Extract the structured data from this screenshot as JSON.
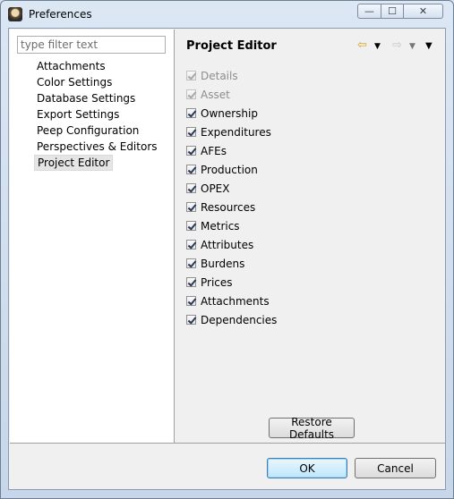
{
  "window": {
    "title": "Preferences",
    "controls": {
      "minimize": "—",
      "maximize": "☐",
      "close": "✕"
    }
  },
  "filter": {
    "placeholder": "type filter text"
  },
  "tree": {
    "items": [
      {
        "label": "Attachments",
        "selected": false
      },
      {
        "label": "Color Settings",
        "selected": false
      },
      {
        "label": "Database Settings",
        "selected": false
      },
      {
        "label": "Export Settings",
        "selected": false
      },
      {
        "label": "Peep Configuration",
        "selected": false
      },
      {
        "label": "Perspectives & Editors",
        "selected": false
      },
      {
        "label": "Project Editor",
        "selected": true
      }
    ]
  },
  "page": {
    "title": "Project Editor",
    "nav": {
      "back_icon": "back-arrow-icon",
      "forward_icon": "forward-arrow-icon",
      "menu_icon": "view-menu-icon"
    },
    "checkboxes": [
      {
        "label": "Details",
        "checked": true,
        "enabled": false
      },
      {
        "label": "Asset",
        "checked": true,
        "enabled": false
      },
      {
        "label": "Ownership",
        "checked": true,
        "enabled": true
      },
      {
        "label": "Expenditures",
        "checked": true,
        "enabled": true
      },
      {
        "label": "AFEs",
        "checked": true,
        "enabled": true
      },
      {
        "label": "Production",
        "checked": true,
        "enabled": true
      },
      {
        "label": "OPEX",
        "checked": true,
        "enabled": true
      },
      {
        "label": "Resources",
        "checked": true,
        "enabled": true
      },
      {
        "label": "Metrics",
        "checked": true,
        "enabled": true
      },
      {
        "label": "Attributes",
        "checked": true,
        "enabled": true
      },
      {
        "label": "Burdens",
        "checked": true,
        "enabled": true
      },
      {
        "label": "Prices",
        "checked": true,
        "enabled": true
      },
      {
        "label": "Attachments",
        "checked": true,
        "enabled": true
      },
      {
        "label": "Dependencies",
        "checked": true,
        "enabled": true
      }
    ],
    "restore_defaults_label": "Restore Defaults"
  },
  "buttons": {
    "ok_label": "OK",
    "cancel_label": "Cancel"
  },
  "colors": {
    "ok_border": "#3c7fb1",
    "back_arrow": "#d9a21b"
  }
}
